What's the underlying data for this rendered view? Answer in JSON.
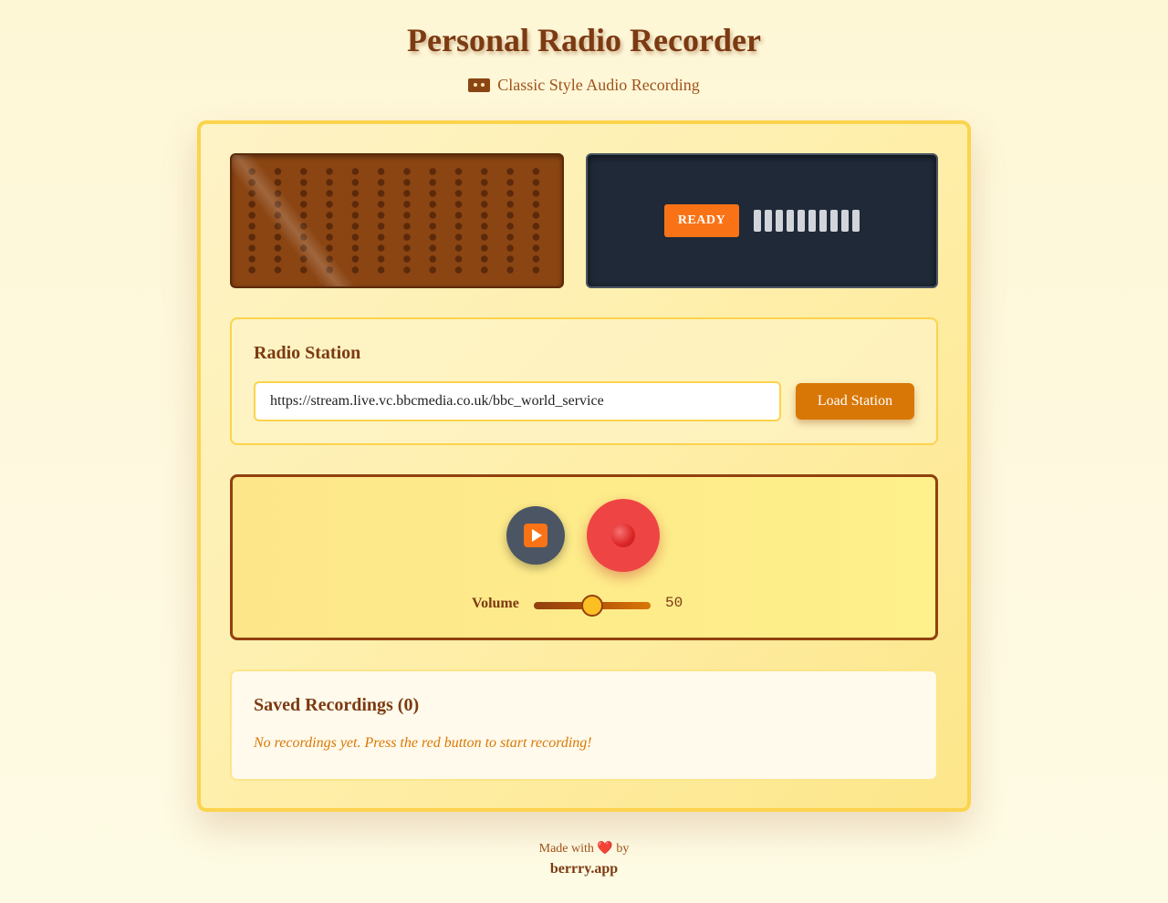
{
  "header": {
    "title": "Personal Radio Recorder",
    "subtitle": "Classic Style Audio Recording",
    "subtitle_icon": "cassette-icon"
  },
  "display": {
    "status": "READY",
    "level_bars": 10,
    "level_fill": 0
  },
  "station": {
    "title": "Radio Station",
    "url_value": "https://stream.live.vc.bbcmedia.co.uk/bbc_world_service",
    "load_label": "Load Station"
  },
  "controls": {
    "play_icon": "play-icon",
    "record_icon": "record-icon",
    "volume_label": "Volume",
    "volume_value": "50",
    "volume_level": 0.5
  },
  "recordings": {
    "title": "Saved Recordings (0)",
    "empty_message": "No recordings yet. Press the red button to start recording!"
  },
  "footer": {
    "made_with": "Made with",
    "heart": "❤️",
    "by": "by",
    "brand": "berrry.app"
  },
  "colors": {
    "accent": "#d97706",
    "brown": "#7c3a12",
    "record_red": "#ef4444",
    "status_orange": "#f97316",
    "display_bg": "#1f2937"
  }
}
